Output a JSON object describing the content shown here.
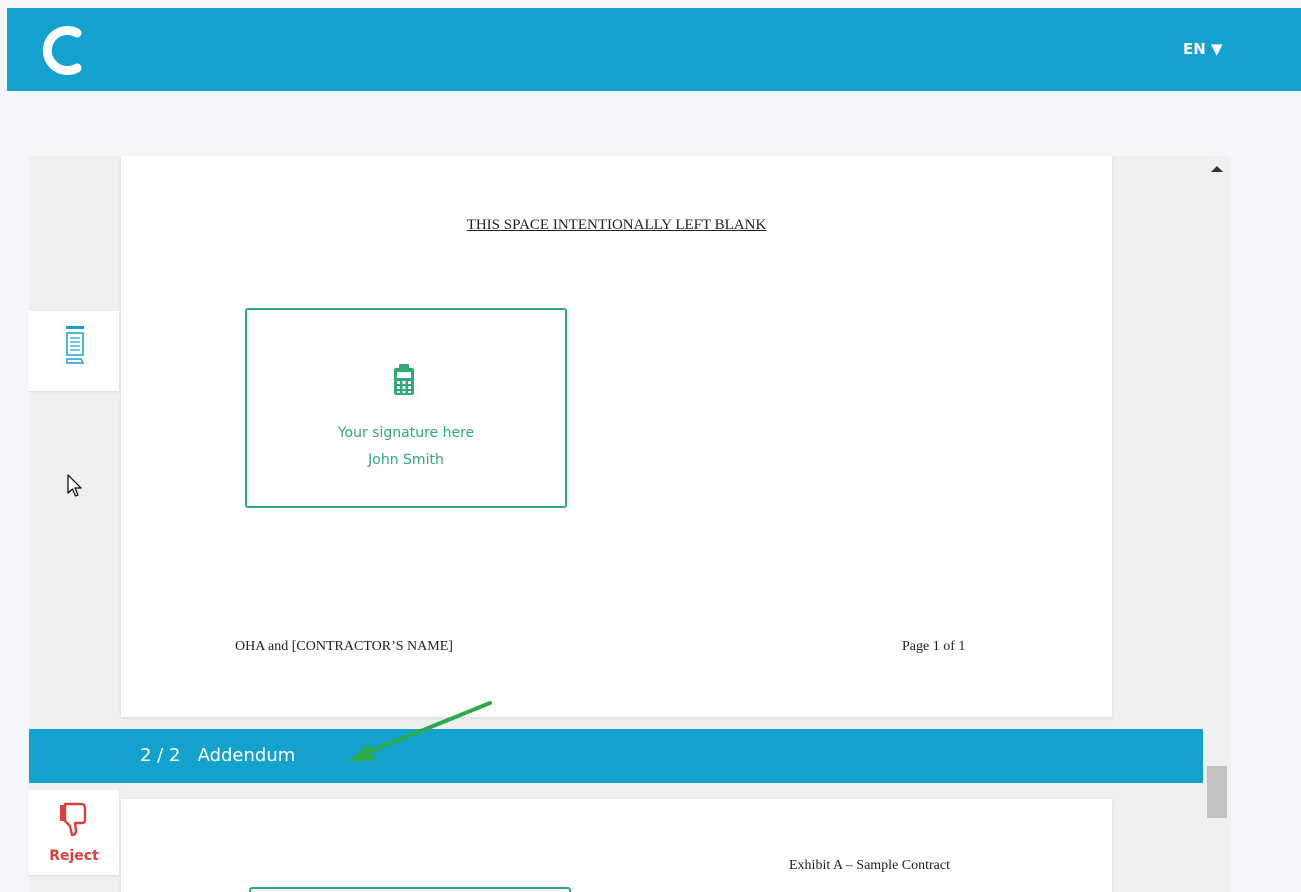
{
  "header": {
    "language": "EN ▼",
    "logo_icon": "c-logo-icon"
  },
  "document": {
    "page1": {
      "blank_notice": "THIS SPACE INTENTIONALLY LEFT BLANK",
      "signature_field": {
        "icon": "signature-tablet-icon",
        "prompt": "Your signature here",
        "signer_name": "John Smith"
      },
      "footer_left": "OHA and [CONTRACTOR’S  NAME]",
      "footer_right": "Page 1 of 1"
    },
    "section_bar": {
      "label": "2 / 2   Addendum"
    },
    "page2": {
      "heading": "Exhibit A – Sample Contract"
    }
  },
  "sidebar": {
    "pages_tool_icon": "document-pages-icon",
    "reject": {
      "icon": "thumbs-down-icon",
      "label": "Reject"
    }
  },
  "colors": {
    "brand": "#13a1ce",
    "signature": "#2daa78",
    "reject": "#d9403e",
    "annotation_arrow": "#2bab4a"
  }
}
